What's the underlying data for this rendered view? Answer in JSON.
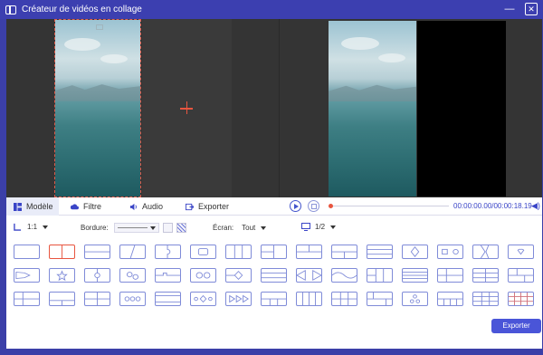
{
  "window": {
    "title": "Créateur de vidéos en collage",
    "minimize": "—",
    "close": "✕"
  },
  "tabs": [
    {
      "label": "Modèle",
      "icon": "template-icon",
      "active": true
    },
    {
      "label": "Filtre",
      "icon": "filter-cloud-icon"
    },
    {
      "label": "Audio",
      "icon": "speaker-icon"
    },
    {
      "label": "Exporter",
      "icon": "export-icon"
    }
  ],
  "player": {
    "time": "00:00:00.00/00:00:18.19",
    "progress": 0
  },
  "options": {
    "ratio": "1:1",
    "border_label": "Bordure:",
    "screen_label": "Écran:",
    "screen_value": "Tout",
    "page": "1/2"
  },
  "templates_count": 45,
  "export_button": "Exporter",
  "colors": {
    "accent": "#4a55d8",
    "titlebar": "#3c3fb0",
    "selection": "#e8553f"
  }
}
